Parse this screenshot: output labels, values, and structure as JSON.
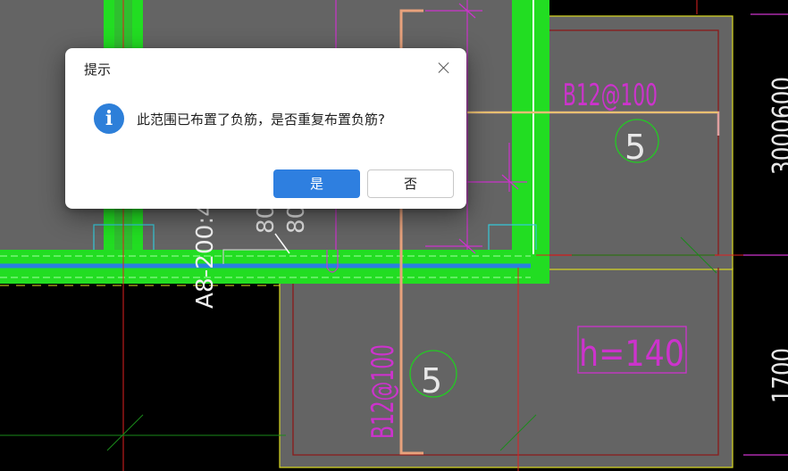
{
  "cad": {
    "labels": {
      "rebar_top": "B12@100",
      "rebar_bottom": "B12@100",
      "rebar_vertical": "A8-200:4",
      "slab_thickness": "h=140",
      "mark_top": "5",
      "mark_bottom": "5",
      "dim_right_top": "3000600",
      "dim_right_bottom": "1700",
      "dim_small": "80",
      "dim_small2": "80"
    }
  },
  "dialog": {
    "title": "提示",
    "icon": "info-icon",
    "message": "此范围已布置了负筋，是否重复布置负筋?",
    "yes_label": "是",
    "no_label": "否"
  },
  "colors": {
    "wall_green": "#22dd22",
    "slab_gray": "#646464",
    "rebar_magenta": "#cc33cc",
    "rebar_orange": "#e8a27c",
    "accent_blue": "#2e7fe0"
  }
}
